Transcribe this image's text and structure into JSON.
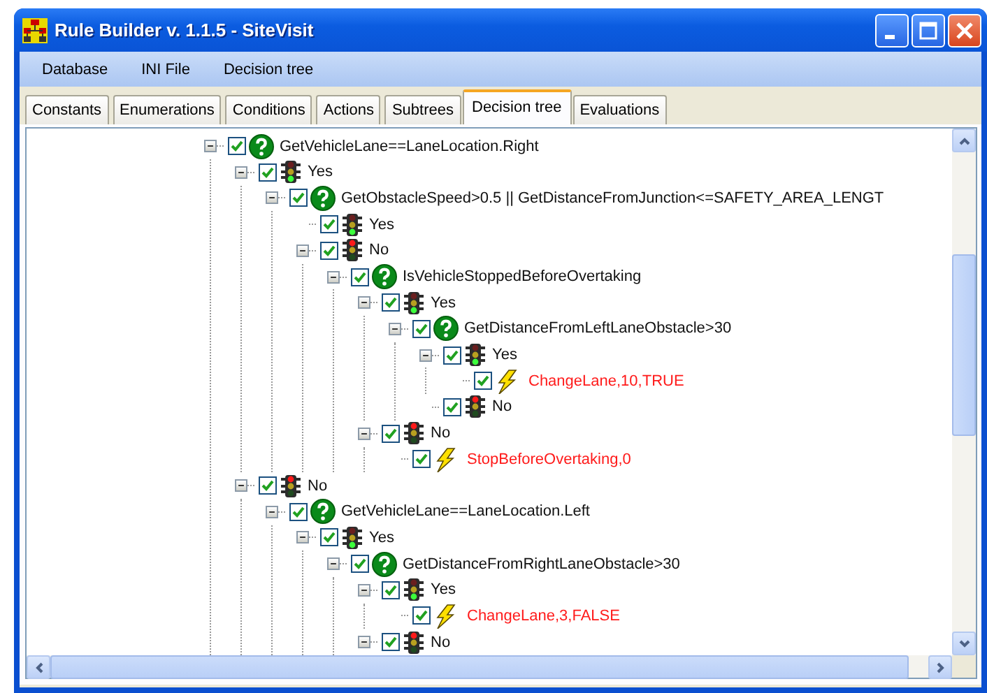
{
  "window": {
    "title": "Rule Builder v. 1.1.5 - SiteVisit"
  },
  "menu": [
    "Database",
    "INI File",
    "Decision tree"
  ],
  "tabs": [
    {
      "label": "Constants",
      "selected": false
    },
    {
      "label": "Enumerations",
      "selected": false
    },
    {
      "label": "Conditions",
      "selected": false
    },
    {
      "label": "Actions",
      "selected": false
    },
    {
      "label": "Subtrees",
      "selected": false
    },
    {
      "label": "Decision tree",
      "selected": true
    },
    {
      "label": "Evaluations",
      "selected": false
    }
  ],
  "tree": [
    {
      "kind": "condition",
      "label": "GetVehicleLane==LaneLocation.Right",
      "checked": true,
      "expanded": true,
      "children": [
        {
          "kind": "yes",
          "label": "Yes",
          "checked": true,
          "expanded": true,
          "children": [
            {
              "kind": "condition",
              "label": "GetObstacleSpeed>0.5 || GetDistanceFromJunction<=SAFETY_AREA_LENGT",
              "checked": true,
              "expanded": true,
              "children": [
                {
                  "kind": "yes",
                  "label": "Yes",
                  "checked": true
                },
                {
                  "kind": "no",
                  "label": "No",
                  "checked": true,
                  "expanded": true,
                  "children": [
                    {
                      "kind": "condition",
                      "label": "IsVehicleStoppedBeforeOvertaking",
                      "checked": true,
                      "expanded": true,
                      "children": [
                        {
                          "kind": "yes",
                          "label": "Yes",
                          "checked": true,
                          "expanded": true,
                          "children": [
                            {
                              "kind": "condition",
                              "label": "GetDistanceFromLeftLaneObstacle>30",
                              "checked": true,
                              "expanded": true,
                              "children": [
                                {
                                  "kind": "yes",
                                  "label": "Yes",
                                  "checked": true,
                                  "expanded": true,
                                  "children": [
                                    {
                                      "kind": "action",
                                      "label": "ChangeLane,10,TRUE",
                                      "checked": true
                                    }
                                  ]
                                },
                                {
                                  "kind": "no",
                                  "label": "No",
                                  "checked": true
                                }
                              ]
                            }
                          ]
                        },
                        {
                          "kind": "no",
                          "label": "No",
                          "checked": true,
                          "expanded": true,
                          "children": [
                            {
                              "kind": "action",
                              "label": "StopBeforeOvertaking,0",
                              "checked": true
                            }
                          ]
                        }
                      ]
                    }
                  ]
                }
              ]
            }
          ]
        },
        {
          "kind": "no",
          "label": "No",
          "checked": true,
          "expanded": true,
          "children": [
            {
              "kind": "condition",
              "label": "GetVehicleLane==LaneLocation.Left",
              "checked": true,
              "expanded": true,
              "children": [
                {
                  "kind": "yes",
                  "label": "Yes",
                  "checked": true,
                  "expanded": true,
                  "children": [
                    {
                      "kind": "condition",
                      "label": "GetDistanceFromRightLaneObstacle>30",
                      "checked": true,
                      "expanded": true,
                      "children": [
                        {
                          "kind": "yes",
                          "label": "Yes",
                          "checked": true,
                          "expanded": true,
                          "children": [
                            {
                              "kind": "action",
                              "label": "ChangeLane,3,FALSE",
                              "checked": true
                            }
                          ]
                        },
                        {
                          "kind": "no",
                          "label": "No",
                          "checked": true,
                          "expanded": true
                        }
                      ]
                    }
                  ]
                }
              ]
            }
          ]
        }
      ]
    }
  ]
}
